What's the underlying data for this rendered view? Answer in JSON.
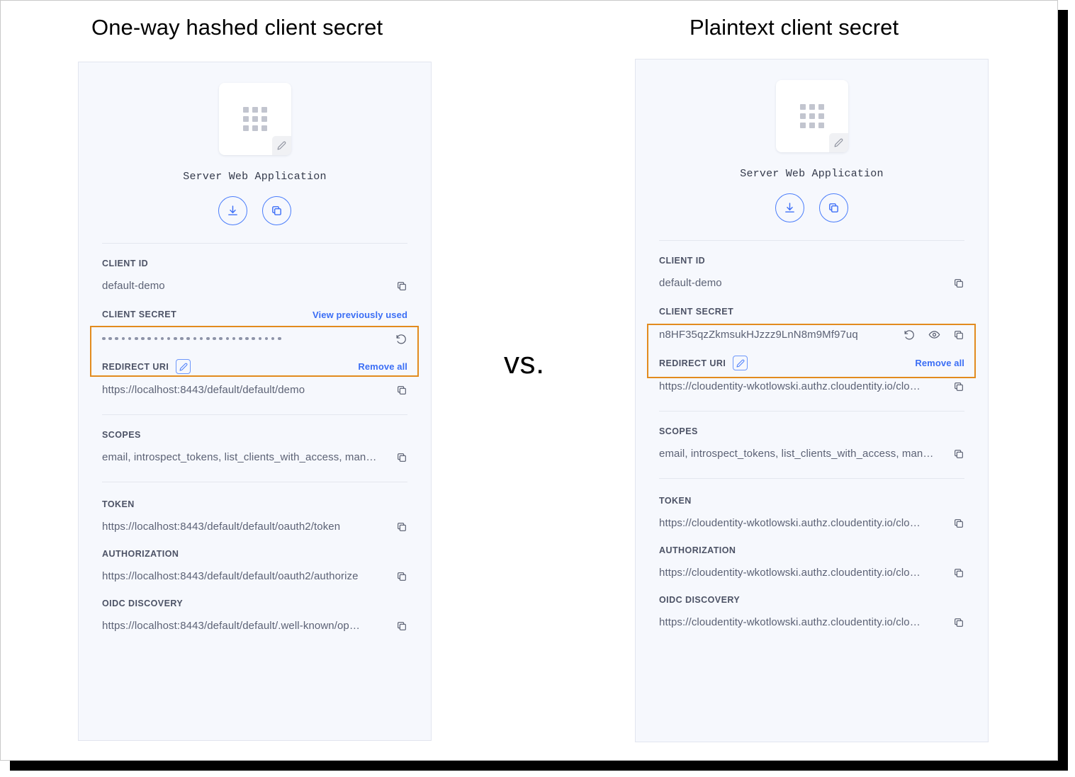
{
  "headings": {
    "left": "One-way hashed client secret",
    "right": "Plaintext client secret",
    "vs": "vs."
  },
  "colors": {
    "highlight_border": "#e28b1e",
    "link_blue": "#3b6ef5",
    "button_blue": "#4a7dfb",
    "card_bg": "#f6f8fd",
    "label_gray": "#4c5265",
    "value_gray": "#5c6275"
  },
  "cards": {
    "hashed": {
      "app_name": "Server Web Application",
      "actions": [
        {
          "name": "download-button",
          "icon": "download-icon"
        },
        {
          "name": "copy-button",
          "icon": "copy-icon"
        }
      ],
      "client_id": {
        "label": "CLIENT ID",
        "value": "default-demo"
      },
      "client_secret": {
        "label": "CLIENT SECRET",
        "link": "View previously used",
        "masked": true,
        "dot_count": 28,
        "value": ""
      },
      "redirect_uri": {
        "label": "REDIRECT URI",
        "link": "Remove all",
        "value": "https://localhost:8443/default/default/demo"
      },
      "scopes": {
        "label": "SCOPES",
        "value": "email, introspect_tokens, list_clients_with_access, man…"
      },
      "token": {
        "label": "TOKEN",
        "value": "https://localhost:8443/default/default/oauth2/token"
      },
      "authorization": {
        "label": "AUTHORIZATION",
        "value": "https://localhost:8443/default/default/oauth2/authorize"
      },
      "oidc_discovery": {
        "label": "OIDC DISCOVERY",
        "value": "https://localhost:8443/default/default/.well-known/op…"
      }
    },
    "plaintext": {
      "app_name": "Server Web Application",
      "actions": [
        {
          "name": "download-button",
          "icon": "download-icon"
        },
        {
          "name": "copy-button",
          "icon": "copy-icon"
        }
      ],
      "client_id": {
        "label": "CLIENT ID",
        "value": "default-demo"
      },
      "client_secret": {
        "label": "CLIENT SECRET",
        "link": "",
        "masked": false,
        "value": "n8HF35qzZkmsukHJzzz9LnN8m9Mf97uq"
      },
      "redirect_uri": {
        "label": "REDIRECT URI",
        "link": "Remove all",
        "value": "https://cloudentity-wkotlowski.authz.cloudentity.io/clo…"
      },
      "scopes": {
        "label": "SCOPES",
        "value": "email, introspect_tokens, list_clients_with_access, man…"
      },
      "token": {
        "label": "TOKEN",
        "value": "https://cloudentity-wkotlowski.authz.cloudentity.io/clo…"
      },
      "authorization": {
        "label": "AUTHORIZATION",
        "value": "https://cloudentity-wkotlowski.authz.cloudentity.io/clo…"
      },
      "oidc_discovery": {
        "label": "OIDC DISCOVERY",
        "value": "https://cloudentity-wkotlowski.authz.cloudentity.io/clo…"
      }
    }
  }
}
